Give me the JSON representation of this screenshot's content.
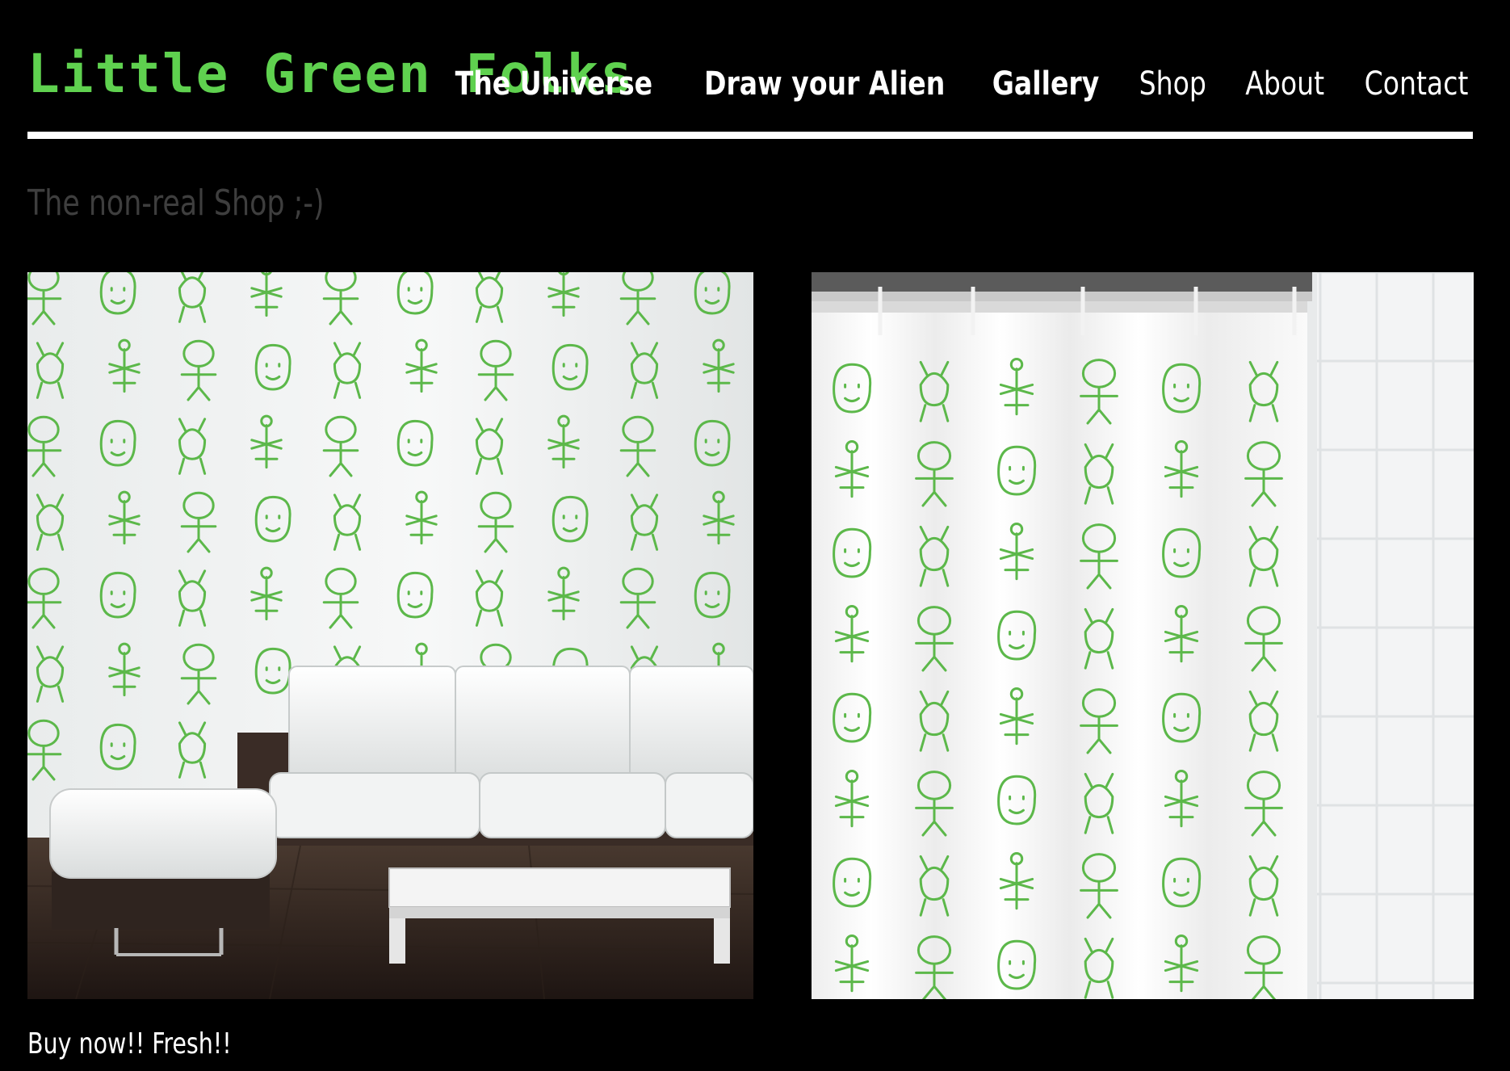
{
  "site": {
    "title": "Little Green Folks",
    "brand_color": "#5fd14f"
  },
  "nav": {
    "items": [
      {
        "label": "The Universe",
        "weight": "bold"
      },
      {
        "label": "Draw your Alien",
        "weight": "bold"
      },
      {
        "label": "Gallery",
        "weight": "bold"
      },
      {
        "label": "Shop",
        "weight": "normal"
      },
      {
        "label": "About",
        "weight": "normal"
      },
      {
        "label": "Contact",
        "weight": "normal"
      }
    ]
  },
  "main": {
    "section_title": "The non-real Shop ;-)",
    "products": [
      {
        "kind": "wallpaper"
      },
      {
        "kind": "shower-curtain"
      }
    ],
    "caption": "Buy now!! Fresh!!"
  },
  "colors": {
    "background": "#000000",
    "text": "#ffffff",
    "muted_heading": "#3e3e3e",
    "doodle_green": "#5cb84a"
  }
}
